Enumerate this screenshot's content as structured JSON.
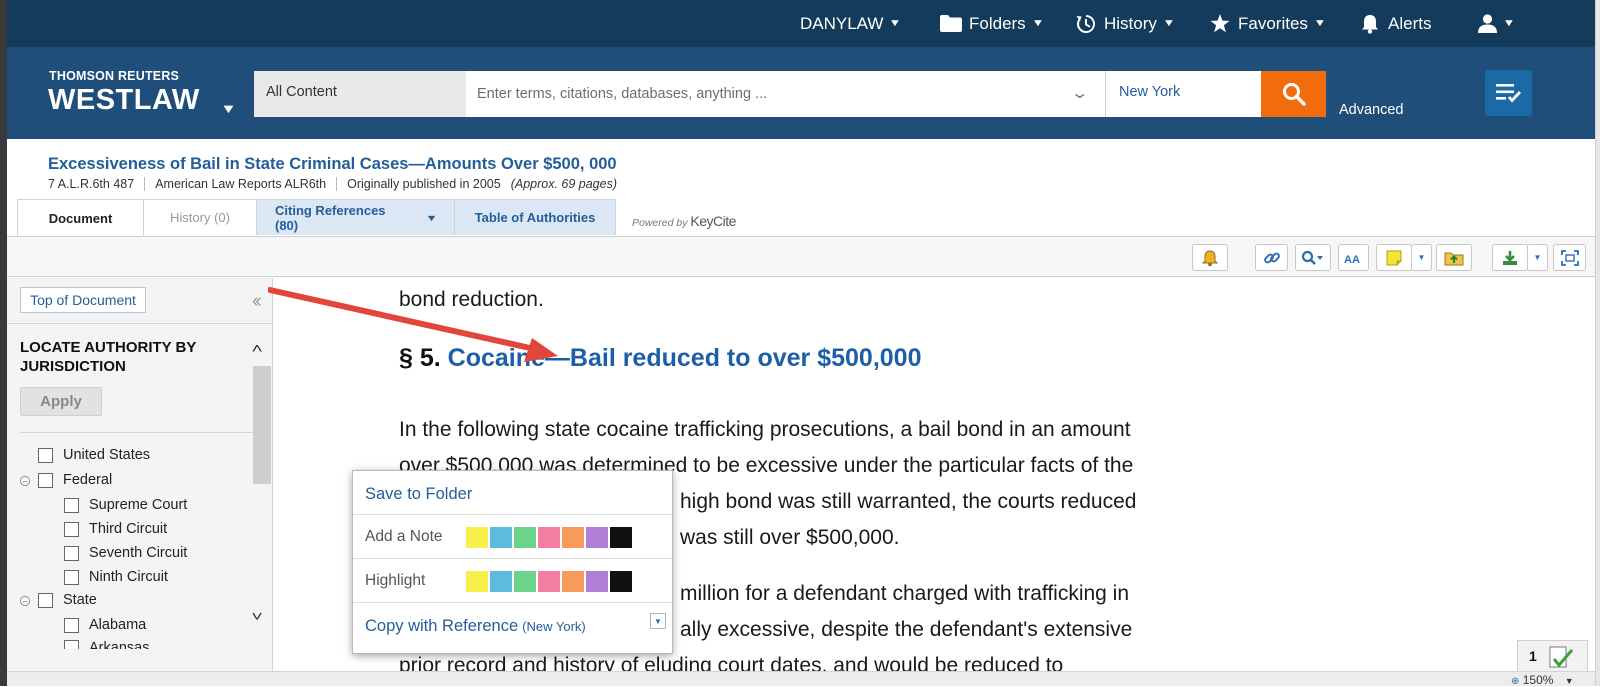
{
  "topnav": {
    "account": "DANYLAW",
    "folders": "Folders",
    "history": "History",
    "favorites": "Favorites",
    "alerts": "Alerts"
  },
  "header": {
    "brand_top": "THOMSON REUTERS",
    "brand_main": "WESTLAW",
    "search_scope": "All Content",
    "search_placeholder": "Enter terms, citations, databases, anything ...",
    "jurisdiction": "New York",
    "advanced": "Advanced",
    "search_button_color": "#f26c0d"
  },
  "document": {
    "title": "Excessiveness of Bail in State Criminal Cases—Amounts Over $500, 000",
    "citation": "7 A.L.R.6th 487",
    "publication": "American Law Reports ALR6th",
    "published": "Originally published in 2005",
    "pages": "(Approx. 69 pages)"
  },
  "tabs": [
    {
      "label": "Document"
    },
    {
      "label": "History (0)"
    },
    {
      "label": "Citing References (80)"
    },
    {
      "label": "Table of Authorities"
    }
  ],
  "keycite": {
    "powered": "Powered by",
    "brand": "KeyCite"
  },
  "toolbar": {
    "icons": [
      "notification-icon",
      "link-icon",
      "search-term-icon",
      "text-size-icon",
      "note-icon",
      "save-folder-icon",
      "download-icon",
      "fullscreen-icon"
    ]
  },
  "sidebar": {
    "top_of_document": "Top of Document",
    "heading": "LOCATE AUTHORITY BY JURISDICTION",
    "apply": "Apply",
    "jurisdictions": {
      "united_states": "United States",
      "federal": "Federal",
      "supreme_court": "Supreme Court",
      "third_circuit": "Third Circuit",
      "seventh_circuit": "Seventh Circuit",
      "ninth_circuit": "Ninth Circuit",
      "state": "State",
      "alabama": "Alabama",
      "arkansas": "Arkansas"
    }
  },
  "content": {
    "line_top": "bond reduction.",
    "section_number": "§ 5.",
    "section_title": "Cocaine—Bail reduced to over $500,000",
    "para1": [
      "In the following state cocaine trafficking prosecutions, a bail bond in an amount",
      "over $500,000 was determined to be excessive under the particular facts of the",
      "high bond was still warranted, the courts reduced",
      "was still over $500,000."
    ],
    "para2": [
      "million for a defendant charged with trafficking in",
      "ally excessive, despite the defendant's extensive",
      "prior record and history of eluding court dates, and would be reduced to"
    ]
  },
  "popup": {
    "save": "Save to Folder",
    "note": "Add a Note",
    "highlight": "Highlight",
    "copy": "Copy with Reference",
    "copy_juris": "(New York)",
    "colors": [
      "#f7f04a",
      "#5bbcdc",
      "#6bd48a",
      "#f27ea0",
      "#f79a5a",
      "#b07fd6",
      "#111111"
    ]
  },
  "status": {
    "page": "1",
    "zoom": "150%"
  }
}
